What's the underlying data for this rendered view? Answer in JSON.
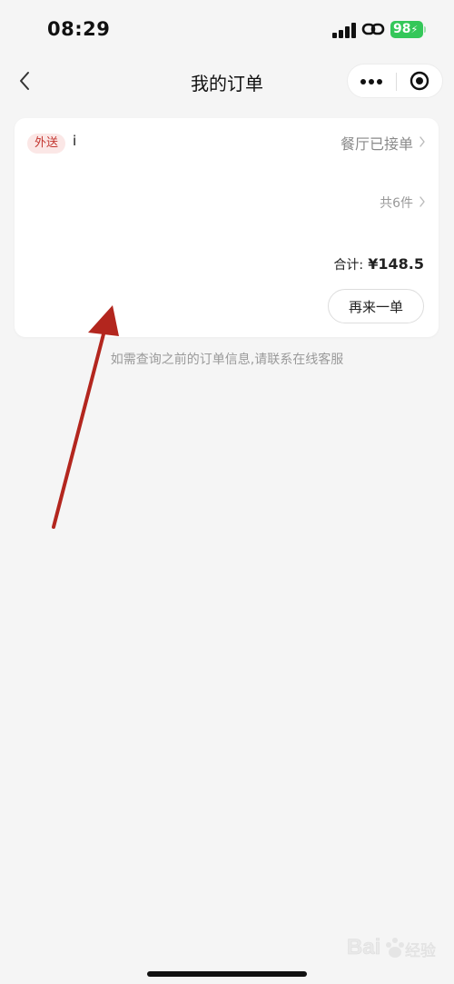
{
  "status_bar": {
    "time": "08:29",
    "battery": "98"
  },
  "nav": {
    "title": "我的订单"
  },
  "order": {
    "badge": "外送",
    "store": "i",
    "status": "餐厅已接单",
    "item_count": "共6件",
    "total_label": "合计:",
    "total_value": "¥148.5",
    "reorder_label": "再来一单"
  },
  "footer": {
    "hint": "如需查询之前的订单信息,请联系在线客服"
  },
  "colors": {
    "accent_red": "#c3352f",
    "badge_bg": "#fbe7e6",
    "battery_green": "#34c759",
    "page_bg": "#f5f5f5",
    "annotation_arrow": "#b3261e"
  },
  "icons": {
    "back": "chevron-left-icon",
    "more": "more-dots-icon",
    "target": "target-icon",
    "signal": "signal-icon",
    "link": "link-icon",
    "battery": "battery-icon",
    "chevron": "chevron-right-icon"
  }
}
